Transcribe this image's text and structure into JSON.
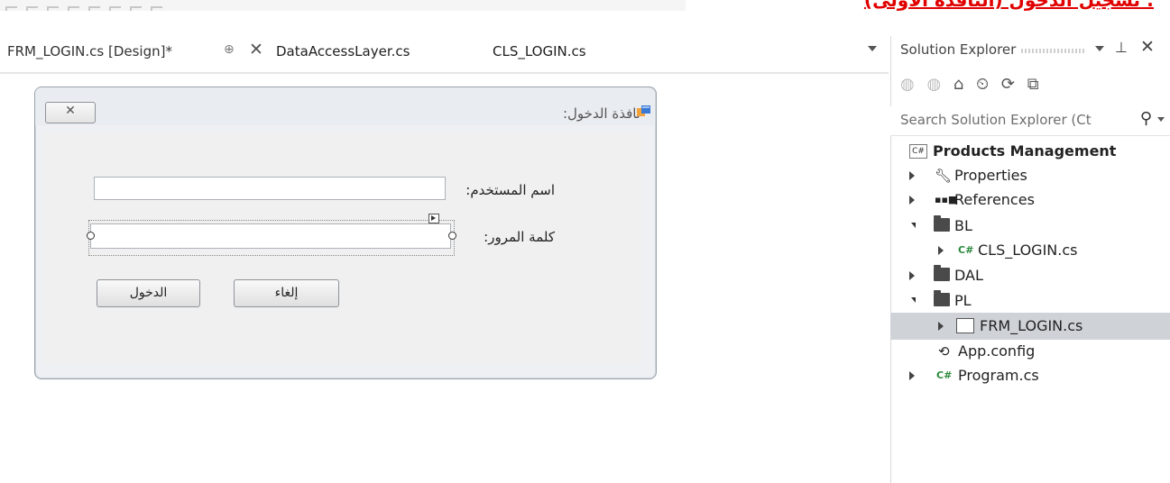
{
  "header_banner": {
    "text": "تسجيل الدخول (النافذة الأولى) :"
  },
  "tabs": [
    {
      "label": "FRM_LOGIN.cs [Design]*",
      "active": true
    },
    {
      "label": "DataAccessLayer.cs",
      "active": false
    },
    {
      "label": "CLS_LOGIN.cs",
      "active": false
    }
  ],
  "tab_controls": {
    "pin": "⊕",
    "close": "✕"
  },
  "form": {
    "title": "نافذة الدخول:",
    "close_button": "✕",
    "username_label": "اسم المستخدم:",
    "username_value": "",
    "password_label": "كلمة المرور:",
    "password_value": "",
    "login_button": "الدخول",
    "cancel_button": "إلغاء"
  },
  "solution_explorer": {
    "title": "Solution Explorer",
    "search_placeholder": "Search Solution Explorer (Ct",
    "toolbar_icons": [
      "back-icon",
      "forward-icon",
      "home-icon",
      "pending-changes-icon",
      "sync-icon",
      "collapse-all-icon"
    ],
    "tree": {
      "project": "Products Management",
      "properties": "Properties",
      "references": "References",
      "bl": "BL",
      "cls_login": "CLS_LOGIN.cs",
      "dal": "DAL",
      "pl": "PL",
      "frm_login": "FRM_LOGIN.cs",
      "app_config": "App.config",
      "program": "Program.cs"
    },
    "selected_item": "FRM_LOGIN.cs"
  },
  "colors": {
    "accent_red": "#e00000",
    "selection": "#cfd3d8",
    "cs_green": "#2a8a3c"
  }
}
